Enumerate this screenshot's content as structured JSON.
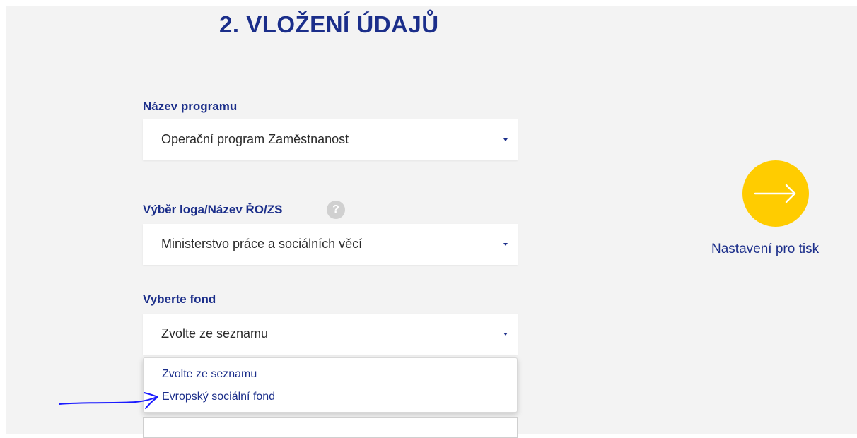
{
  "header": {
    "title": "2. VLOŽENÍ ÚDAJŮ"
  },
  "form": {
    "program": {
      "label": "Název programu",
      "value": "Operační program Zaměstnanost"
    },
    "logo": {
      "label": "Výběr loga/Název ŘO/ZS",
      "help_icon": "?",
      "value": "Ministerstvo práce a sociálních věcí"
    },
    "fund": {
      "label": "Vyberte fond",
      "value": "Zvolte ze seznamu",
      "options": [
        "Zvolte ze seznamu",
        "Evropský sociální fond"
      ]
    }
  },
  "next": {
    "label": "Nastavení pro tisk",
    "icon": "arrow-right-icon"
  },
  "colors": {
    "accent": "#1b2e8a",
    "button": "#ffcc00",
    "background": "#f3f3f3",
    "annotation": "#1a1aff"
  }
}
